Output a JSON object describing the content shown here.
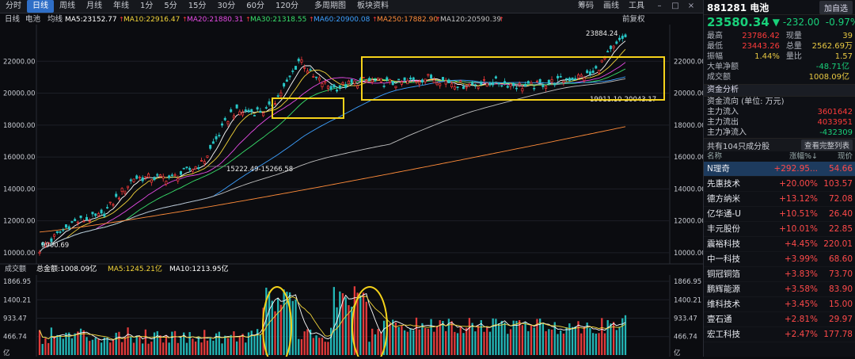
{
  "toolbar": {
    "tabs": [
      "分时",
      "日线",
      "周线",
      "月线",
      "年线",
      "1分",
      "5分",
      "15分",
      "30分",
      "60分",
      "120分",
      "多周期图",
      "板块资料"
    ],
    "right": [
      "筹码",
      "画线",
      "工具"
    ]
  },
  "chart_header": {
    "period": "日线",
    "name": "电池",
    "kind": "均线",
    "ma": [
      {
        "label": "MA5:23152.77",
        "color": "#ffffff"
      },
      {
        "label": "MA10:22916.47",
        "color": "#f2d43a"
      },
      {
        "label": "MA20:21880.31",
        "color": "#e64ce6"
      },
      {
        "label": "MA30:21318.55",
        "color": "#38e06b"
      },
      {
        "label": "MA60:20900.08",
        "color": "#3da0ff"
      },
      {
        "label": "MA250:17882.90",
        "color": "#ff8c3a"
      },
      {
        "label": "MA120:20590.39",
        "color": "#c0c0c0"
      }
    ],
    "restore": "前复权"
  },
  "price_axis": [
    "22000.00",
    "20000.00",
    "18000.00",
    "16000.00",
    "14000.00",
    "12000.00",
    "10000.00"
  ],
  "annotations": {
    "high": "23884.24",
    "low": "9900.69",
    "mid_low": "15222.49-15266.58",
    "range": "19911.10-20043.17"
  },
  "volume_header": {
    "label": "成交额",
    "total": "总金额:1008.09亿",
    "ma5": "MA5:1245.21亿",
    "ma10": "MA10:1213.95亿"
  },
  "volume_axis": [
    "1866.95",
    "1400.21",
    "933.47",
    "466.74",
    "亿"
  ],
  "chart_data": {
    "type": "candlestick",
    "title": "电池",
    "price_ylim": [
      9500,
      24000
    ],
    "price_ticks": [
      10000,
      12000,
      14000,
      16000,
      18000,
      20000,
      22000
    ],
    "volume_ticks": [
      466.74,
      933.47,
      1400.21,
      1866.95
    ],
    "volume_unit": "亿",
    "high": 23884.24,
    "low": 9900.69
  },
  "panel": {
    "code": "881281",
    "name": "电池",
    "add_btn": "加自选",
    "price": "23580.34",
    "change": "-232.00",
    "pct": "-0.97%",
    "quote": [
      {
        "l": "最高",
        "v": "23786.42",
        "l2": "现量",
        "v2": "39"
      },
      {
        "l": "最低",
        "v": "23443.26",
        "l2": "总量",
        "v2": "2562.69万"
      },
      {
        "l": "振幅",
        "v": "1.44%",
        "l2": "量比",
        "v2": "1.57"
      }
    ],
    "big_order": {
      "l": "大单净额",
      "v": "-48.71亿"
    },
    "turnover": {
      "l": "成交额",
      "v": "1008.09亿"
    },
    "fund_title": "资金分析",
    "fund_sub": "资金流向 (单位: 万元)",
    "funds": [
      {
        "l": "主力流入",
        "v": "3601642"
      },
      {
        "l": "主力流出",
        "v": "4033951"
      },
      {
        "l": "主力净流入",
        "v": "-432309"
      }
    ],
    "list_title": "共有104只成分股",
    "list_btn": "查看完整列表",
    "cols": [
      "名称",
      "涨幅%↓",
      "现价"
    ],
    "stocks": [
      {
        "n": "N理奇",
        "p": "+292.95...",
        "v": "54.66"
      },
      {
        "n": "先惠技术",
        "p": "+20.00%",
        "v": "103.57"
      },
      {
        "n": "德方纳米",
        "p": "+13.12%",
        "v": "72.08"
      },
      {
        "n": "亿华通-U",
        "p": "+10.51%",
        "v": "26.40"
      },
      {
        "n": "丰元股份",
        "p": "+10.01%",
        "v": "22.85"
      },
      {
        "n": "震裕科技",
        "p": "+4.45%",
        "v": "220.01"
      },
      {
        "n": "中一科技",
        "p": "+3.99%",
        "v": "68.60"
      },
      {
        "n": "铜冠铜箔",
        "p": "+3.83%",
        "v": "73.70"
      },
      {
        "n": "鹏辉能源",
        "p": "+3.58%",
        "v": "83.90"
      },
      {
        "n": "维科技术",
        "p": "+3.45%",
        "v": "15.00"
      },
      {
        "n": "壹石通",
        "p": "+2.81%",
        "v": "29.97"
      },
      {
        "n": "宏工科技",
        "p": "+2.47%",
        "v": "177.78"
      }
    ]
  }
}
